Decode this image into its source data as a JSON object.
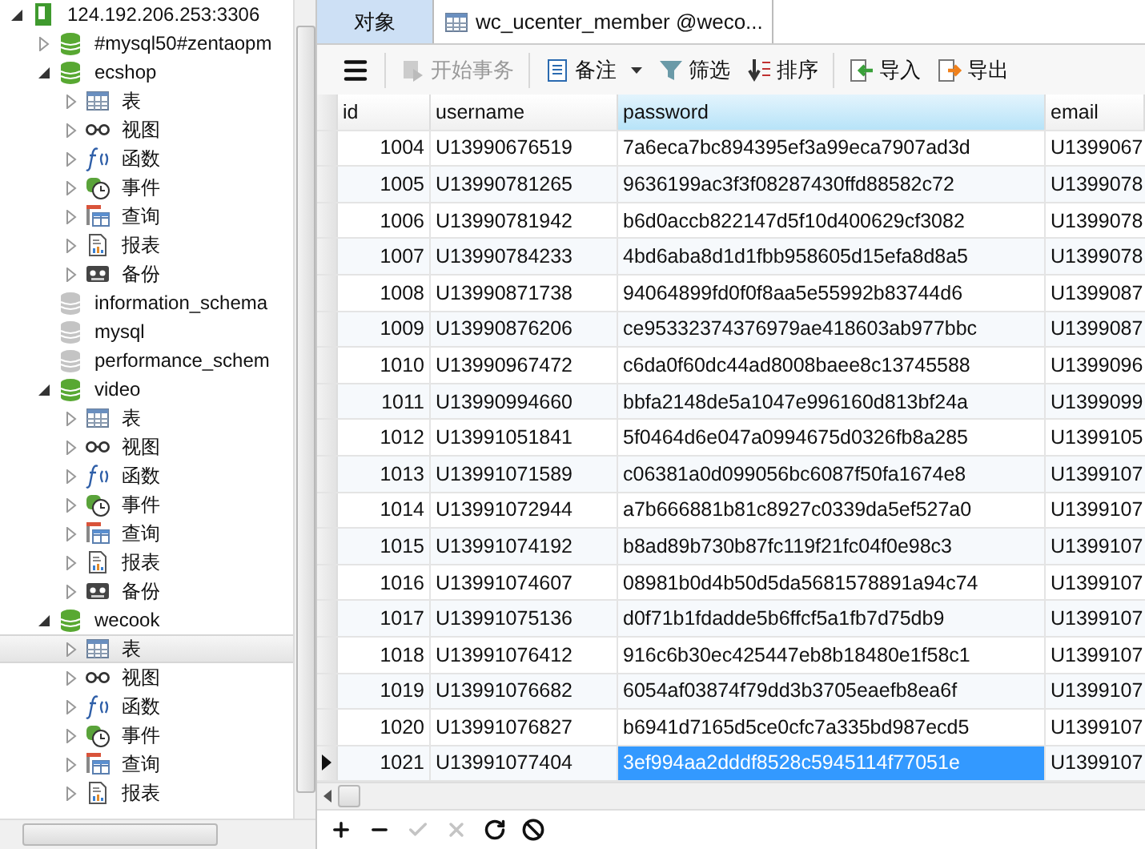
{
  "tree": [
    {
      "kind": "server",
      "label": "124.192.206.253:3306",
      "expanded": true,
      "selected": false,
      "children": [
        {
          "kind": "database",
          "label": "#mysql50#zentaopm",
          "open": true,
          "expanded": false,
          "selected": false
        },
        {
          "kind": "database",
          "label": "ecshop",
          "open": true,
          "expanded": true,
          "selected": false,
          "children": [
            {
              "kind": "table",
              "label": "表",
              "expanded": false,
              "selected": false
            },
            {
              "kind": "view",
              "label": "视图",
              "expanded": false,
              "selected": false
            },
            {
              "kind": "function",
              "label": "函数",
              "expanded": false,
              "selected": false
            },
            {
              "kind": "event",
              "label": "事件",
              "expanded": false,
              "selected": false
            },
            {
              "kind": "query",
              "label": "查询",
              "expanded": false,
              "selected": false
            },
            {
              "kind": "report",
              "label": "报表",
              "expanded": false,
              "selected": false
            },
            {
              "kind": "backup",
              "label": "备份",
              "expanded": false,
              "selected": false
            }
          ]
        },
        {
          "kind": "database",
          "label": "information_schema",
          "open": false,
          "selected": false
        },
        {
          "kind": "database",
          "label": "mysql",
          "open": false,
          "selected": false
        },
        {
          "kind": "database",
          "label": "performance_schem",
          "open": false,
          "selected": false
        },
        {
          "kind": "database",
          "label": "video",
          "open": true,
          "expanded": true,
          "selected": false,
          "children": [
            {
              "kind": "table",
              "label": "表",
              "expanded": false,
              "selected": false
            },
            {
              "kind": "view",
              "label": "视图",
              "expanded": false,
              "selected": false
            },
            {
              "kind": "function",
              "label": "函数",
              "expanded": false,
              "selected": false
            },
            {
              "kind": "event",
              "label": "事件",
              "expanded": false,
              "selected": false
            },
            {
              "kind": "query",
              "label": "查询",
              "expanded": false,
              "selected": false
            },
            {
              "kind": "report",
              "label": "报表",
              "expanded": false,
              "selected": false
            },
            {
              "kind": "backup",
              "label": "备份",
              "expanded": false,
              "selected": false
            }
          ]
        },
        {
          "kind": "database",
          "label": "wecook",
          "open": true,
          "expanded": true,
          "selected": false,
          "children": [
            {
              "kind": "table",
              "label": "表",
              "expanded": false,
              "selected": true
            },
            {
              "kind": "view",
              "label": "视图",
              "expanded": false,
              "selected": false
            },
            {
              "kind": "function",
              "label": "函数",
              "expanded": false,
              "selected": false
            },
            {
              "kind": "event",
              "label": "事件",
              "expanded": false,
              "selected": false
            },
            {
              "kind": "query",
              "label": "查询",
              "expanded": false,
              "selected": false
            },
            {
              "kind": "report",
              "label": "报表",
              "expanded": false,
              "selected": false
            }
          ]
        }
      ]
    }
  ],
  "tabs": [
    {
      "label": "对象",
      "selected": false
    },
    {
      "kind": "table",
      "label": "wc_ucenter_member @weco...",
      "selected": true
    }
  ],
  "toolbar": [
    [
      {
        "kind": "menu",
        "disabled": false
      }
    ],
    [
      {
        "kind": "transaction",
        "label": "开始事务",
        "disabled": true
      }
    ],
    [
      {
        "kind": "note",
        "label": "备注",
        "disabled": false,
        "dropdown": true
      },
      {
        "kind": "filter",
        "label": "筛选",
        "disabled": false
      },
      {
        "kind": "sort",
        "label": "排序",
        "disabled": false
      }
    ],
    [
      {
        "kind": "import",
        "label": "导入",
        "disabled": false
      },
      {
        "kind": "export",
        "label": "导出",
        "disabled": false
      }
    ]
  ],
  "table": {
    "columns": [
      {
        "label": "id",
        "selected": false
      },
      {
        "label": "username",
        "selected": false
      },
      {
        "label": "password",
        "selected": true
      },
      {
        "label": "email",
        "selected": false
      }
    ],
    "rows": [
      {
        "selected": false,
        "cells": [
          "1004",
          "U13990676519",
          "7a6eca7bc894395ef3a99eca7907ad3d",
          "U1399067"
        ]
      },
      {
        "selected": false,
        "cells": [
          "1005",
          "U13990781265",
          "9636199ac3f3f08287430ffd88582c72",
          "U1399078"
        ]
      },
      {
        "selected": false,
        "cells": [
          "1006",
          "U13990781942",
          "b6d0accb822147d5f10d400629cf3082",
          "U1399078"
        ]
      },
      {
        "selected": false,
        "cells": [
          "1007",
          "U13990784233",
          "4bd6aba8d1d1fbb958605d15efa8d8a5",
          "U1399078"
        ]
      },
      {
        "selected": false,
        "cells": [
          "1008",
          "U13990871738",
          "94064899fd0f0f8aa5e55992b83744d6",
          "U1399087"
        ]
      },
      {
        "selected": false,
        "cells": [
          "1009",
          "U13990876206",
          "ce95332374376979ae418603ab977bbc",
          "U1399087"
        ]
      },
      {
        "selected": false,
        "cells": [
          "1010",
          "U13990967472",
          "c6da0f60dc44ad8008baee8c13745588",
          "U1399096"
        ]
      },
      {
        "selected": false,
        "cells": [
          "1011",
          "U13990994660",
          "bbfa2148de5a1047e996160d813bf24a",
          "U1399099"
        ]
      },
      {
        "selected": false,
        "cells": [
          "1012",
          "U13991051841",
          "5f0464d6e047a0994675d0326fb8a285",
          "U1399105"
        ]
      },
      {
        "selected": false,
        "cells": [
          "1013",
          "U13991071589",
          "c06381a0d099056bc6087f50fa1674e8",
          "U1399107"
        ]
      },
      {
        "selected": false,
        "cells": [
          "1014",
          "U13991072944",
          "a7b666881b81c8927c0339da5ef527a0",
          "U1399107"
        ]
      },
      {
        "selected": false,
        "cells": [
          "1015",
          "U13991074192",
          "b8ad89b730b87fc119f21fc04f0e98c3",
          "U1399107"
        ]
      },
      {
        "selected": false,
        "cells": [
          "1016",
          "U13991074607",
          "08981b0d4b50d5da5681578891a94c74",
          "U1399107"
        ]
      },
      {
        "selected": false,
        "cells": [
          "1017",
          "U13991075136",
          "d0f71b1fdadde5b6ffcf5a1fb7d75db9",
          "U1399107"
        ]
      },
      {
        "selected": false,
        "cells": [
          "1018",
          "U13991076412",
          "916c6b30ec425447eb8b18480e1f58c1",
          "U1399107"
        ]
      },
      {
        "selected": false,
        "cells": [
          "1019",
          "U13991076682",
          "6054af03874f79dd3b3705eaefb8ea6f",
          "U1399107"
        ]
      },
      {
        "selected": false,
        "cells": [
          "1020",
          "U13991076827",
          "b6941d7165d5ce0cfc7a335bd987ecd5",
          "U1399107"
        ]
      },
      {
        "selected": true,
        "cells": [
          "1021",
          "U13991077404",
          "3ef994aa2dddf8528c5945114f77051e",
          "U1399107"
        ]
      }
    ]
  },
  "bottom_bar": [
    {
      "kind": "add",
      "disabled": false
    },
    {
      "kind": "remove",
      "disabled": false
    },
    {
      "kind": "apply",
      "disabled": true
    },
    {
      "kind": "discard",
      "disabled": true
    },
    {
      "kind": "refresh",
      "disabled": false
    },
    {
      "kind": "stop",
      "disabled": false
    }
  ]
}
